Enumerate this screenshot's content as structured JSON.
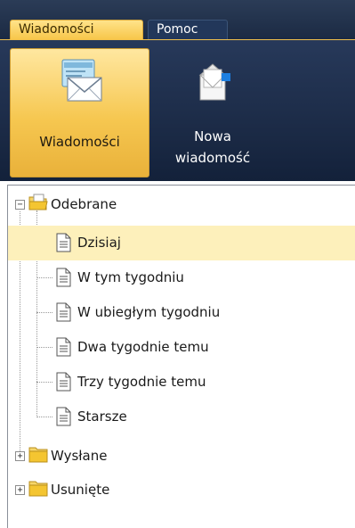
{
  "tabs": [
    {
      "label": "Wiadomości",
      "active": true
    },
    {
      "label": "Pomoc",
      "active": false
    }
  ],
  "ribbon": {
    "messages_label": "Wiadomości",
    "new_message_line1": "Nowa",
    "new_message_line2": "wiadomość"
  },
  "tree": {
    "inbox": {
      "label": "Odebrane",
      "expanded": true,
      "expander": "−"
    },
    "inbox_children": [
      {
        "label": "Dzisiaj",
        "selected": true
      },
      {
        "label": "W tym tygodniu"
      },
      {
        "label": "W ubiegłym tygodniu"
      },
      {
        "label": "Dwa tygodnie temu"
      },
      {
        "label": "Trzy tygodnie temu"
      },
      {
        "label": "Starsze"
      }
    ],
    "sent": {
      "label": "Wysłane",
      "expander": "+"
    },
    "deleted": {
      "label": "Usunięte",
      "expander": "+"
    }
  },
  "colors": {
    "ribbon_bg": "#1b2a43",
    "active_tab": "#f7c547",
    "selected_row": "#fdf0bb",
    "folder": "#f4c531"
  }
}
